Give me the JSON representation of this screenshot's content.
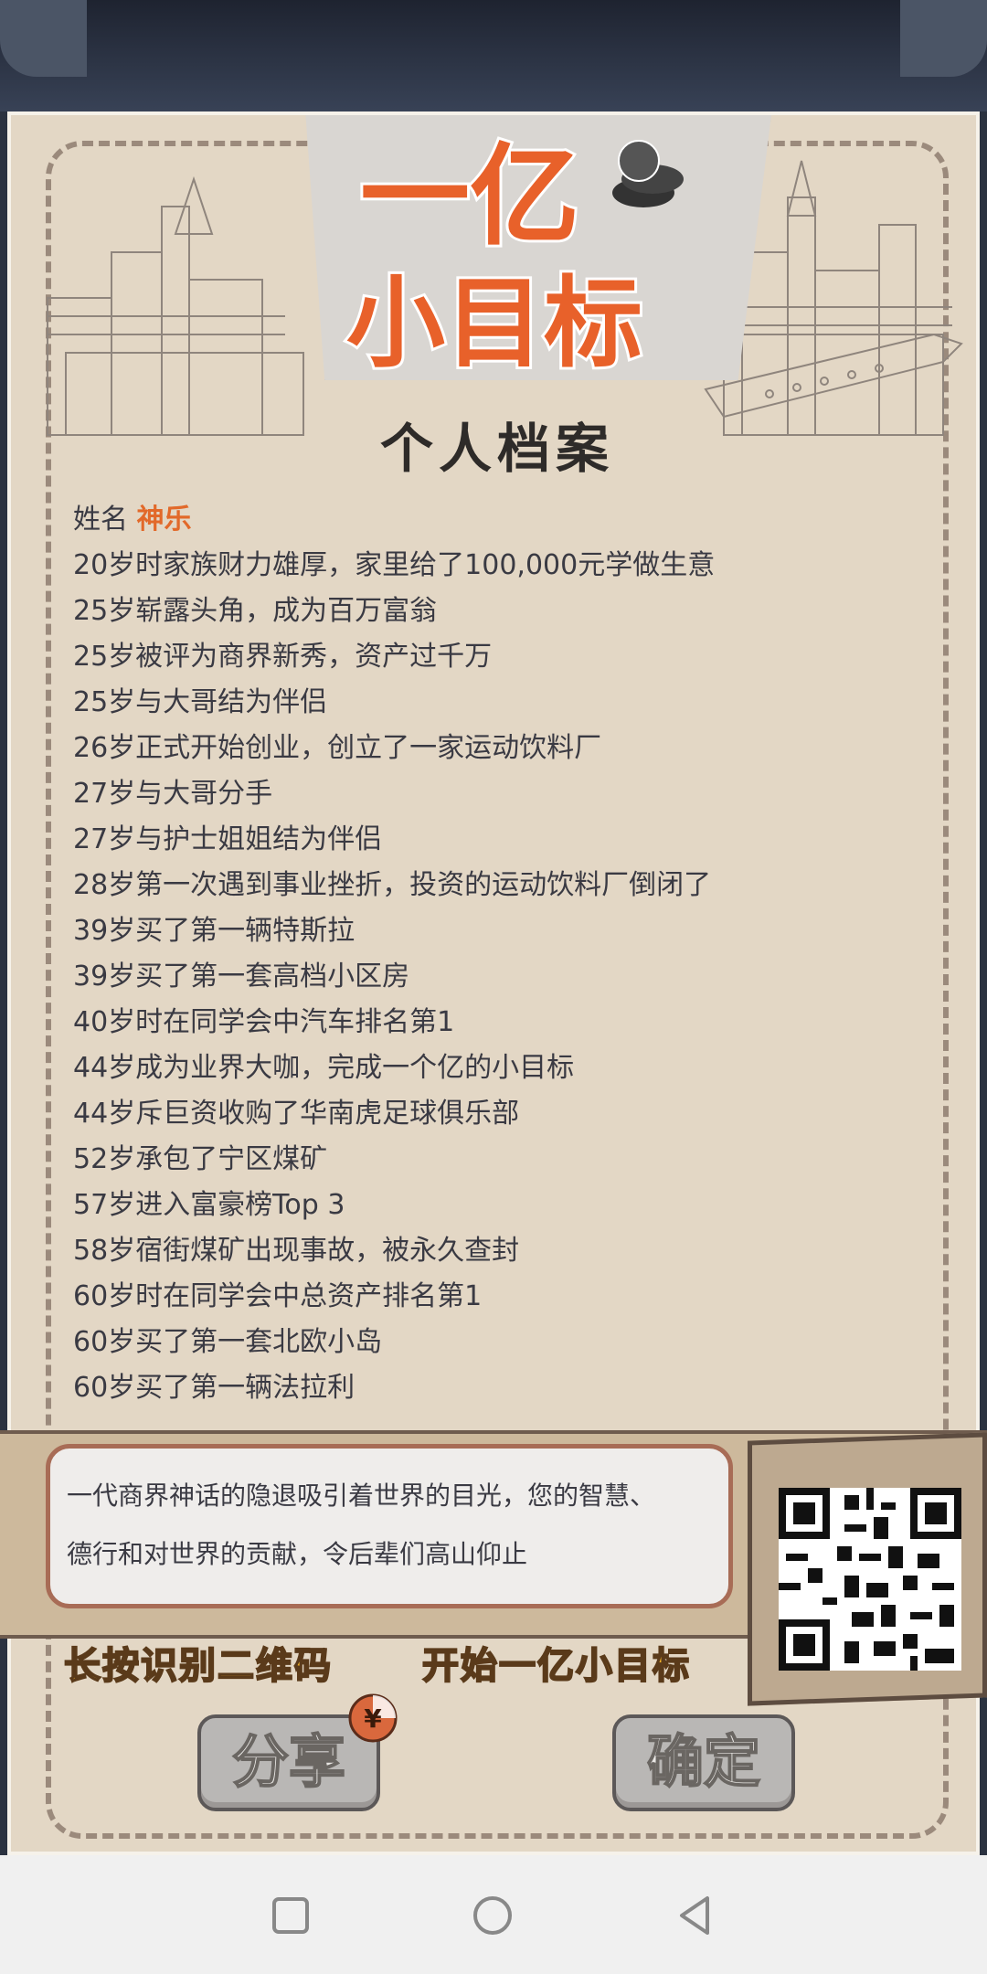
{
  "header": {
    "logo_line1": "一亿",
    "logo_line2": "小目标"
  },
  "profile": {
    "title": "个人档案",
    "name_label": "姓名",
    "name_value": "神乐",
    "events": [
      "20岁时家族财力雄厚，家里给了100,000元学做生意",
      "25岁崭露头角，成为百万富翁",
      "25岁被评为商界新秀，资产过千万",
      "25岁与大哥结为伴侣",
      "26岁正式开始创业，创立了一家运动饮料厂",
      "27岁与大哥分手",
      "27岁与护士姐姐结为伴侣",
      "28岁第一次遇到事业挫折，投资的运动饮料厂倒闭了",
      "39岁买了第一辆特斯拉",
      "39岁买了第一套高档小区房",
      "40岁时在同学会中汽车排名第1",
      "44岁成为业界大咖，完成一个亿的小目标",
      "44岁斥巨资收购了华南虎足球俱乐部",
      "52岁承包了宁区煤矿",
      "57岁进入富豪榜Top 3",
      "58岁宿街煤矿出现事故，被永久查封",
      "60岁时在同学会中总资产排名第1",
      "60岁买了第一套北欧小岛",
      "60岁买了第一辆法拉利"
    ]
  },
  "summary": {
    "line1": "一代商界神话的隐退吸引着世界的目光，您的智慧、",
    "line2": "德行和对世界的贡献，令后辈们高山仰止"
  },
  "captions": {
    "scan": "长按识别二维码",
    "start": "开始一亿小目标"
  },
  "buttons": {
    "share": "分享",
    "confirm": "确定"
  },
  "coin_symbol": "¥",
  "colors": {
    "accent": "#e2692a",
    "paper": "#e3d7c5",
    "caption": "#f6b52a"
  },
  "icons": [
    "square-recent-icon",
    "circle-home-icon",
    "triangle-back-icon",
    "qr-code-icon",
    "yen-coin-icon"
  ]
}
